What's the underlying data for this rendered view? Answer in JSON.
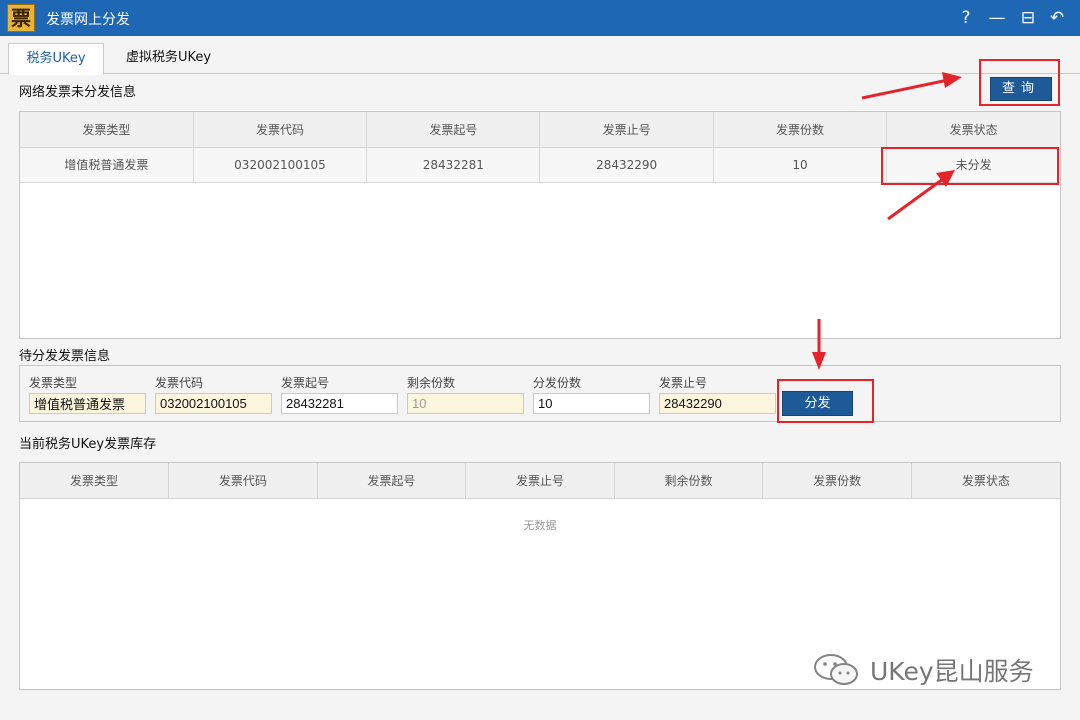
{
  "window": {
    "logo_char": "票",
    "title": "发票网上分发",
    "controls": {
      "help": "?",
      "minimize": "—",
      "maximize": "⊟",
      "restore": "↶"
    }
  },
  "tabs": [
    {
      "label": "税务UKey",
      "active": true
    },
    {
      "label": "虚拟税务UKey",
      "active": false
    }
  ],
  "undistributed": {
    "title": "网络发票未分发信息",
    "query_label": "查询",
    "columns": [
      "发票类型",
      "发票代码",
      "发票起号",
      "发票止号",
      "发票份数",
      "发票状态"
    ],
    "rows": [
      [
        "增值税普通发票",
        "032002100105",
        "28432281",
        "28432290",
        "10",
        "未分发"
      ]
    ]
  },
  "pending": {
    "title": "待分发发票信息",
    "fields": [
      {
        "label": "发票类型",
        "value": "增值税普通发票"
      },
      {
        "label": "发票代码",
        "value": "032002100105"
      },
      {
        "label": "发票起号",
        "value": "28432281"
      },
      {
        "label": "剩余份数",
        "value": "10"
      },
      {
        "label": "分发份数",
        "value": "10"
      },
      {
        "label": "发票止号",
        "value": "28432290"
      }
    ],
    "distribute_label": "分发"
  },
  "inventory": {
    "title": "当前税务UKey发票库存",
    "columns": [
      "发票类型",
      "发票代码",
      "发票起号",
      "发票止号",
      "剩余份数",
      "发票份数",
      "发票状态"
    ],
    "empty_text": "无数据"
  },
  "watermark": {
    "text": "UKey昆山服务",
    "icon": "wechat-icon"
  },
  "colors": {
    "titlebar": "#1e67b5",
    "button": "#1e5a98",
    "annotation": "#e5232b"
  }
}
